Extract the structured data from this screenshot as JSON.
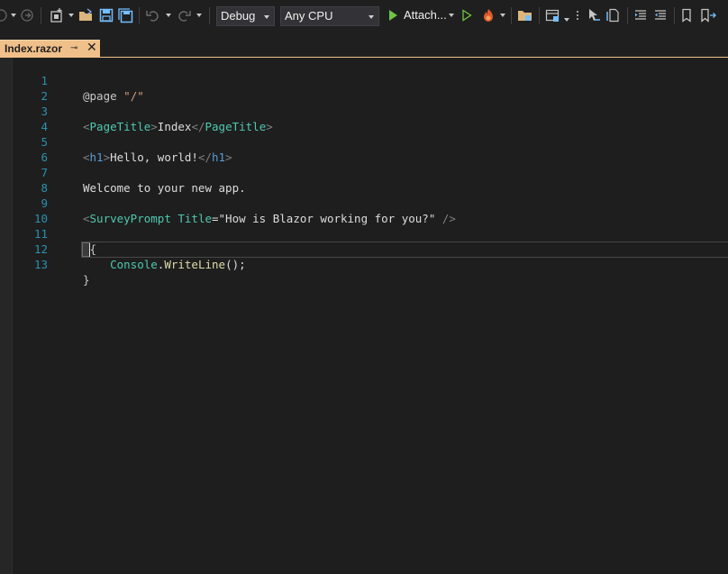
{
  "toolbar": {
    "configuration": "Debug",
    "platform": "Any CPU",
    "attach_label": "Attach...",
    "icons": [
      "back-icon",
      "forward-icon",
      "new-project-icon",
      "open-folder-icon",
      "save-icon",
      "save-all-icon",
      "undo-icon",
      "redo-icon",
      "start-icon",
      "start-without-debug-icon",
      "hot-reload-icon",
      "solution-explorer-icon",
      "layout-icon",
      "pointer-icon",
      "file-icon",
      "indent-icon",
      "outdent-icon",
      "bookmark-icon",
      "bookmark-next-icon"
    ]
  },
  "tab": {
    "title": "Index.razor",
    "pin": "⊸",
    "close": "✕"
  },
  "editor": {
    "line_numbers": [
      "1",
      "2",
      "3",
      "4",
      "5",
      "6",
      "7",
      "8",
      "9",
      "10",
      "11",
      "12",
      "13"
    ],
    "lines": {
      "l1_a": "@page",
      "l1_b": " \"/\"",
      "l3_a": "<",
      "l3_b": "PageTitle",
      "l3_c": ">",
      "l3_d": "Index",
      "l3_e": "</",
      "l3_f": "PageTitle",
      "l3_g": ">",
      "l5_a": "<",
      "l5_b": "h1",
      "l5_c": ">",
      "l5_d": "Hello, world!",
      "l5_e": "</",
      "l5_f": "h1",
      "l5_g": ">",
      "l7": "Welcome to your new app.",
      "l9_a": "<",
      "l9_b": "SurveyPrompt",
      "l9_c": " Title",
      "l9_d": "=",
      "l9_e": "\"How is Blazor working for you?\"",
      "l9_f": " />",
      "l11": "@{",
      "l12_a": "    ",
      "l12_b": "Console",
      "l12_c": ".",
      "l12_d": "WriteLine",
      "l12_e": "();",
      "l13": "}"
    }
  },
  "colors": {
    "tab_active": "#f0c08a",
    "line_number": "#2b91af",
    "component": "#4ec9b0",
    "string": "#d69d85",
    "method": "#dcdcaa"
  }
}
